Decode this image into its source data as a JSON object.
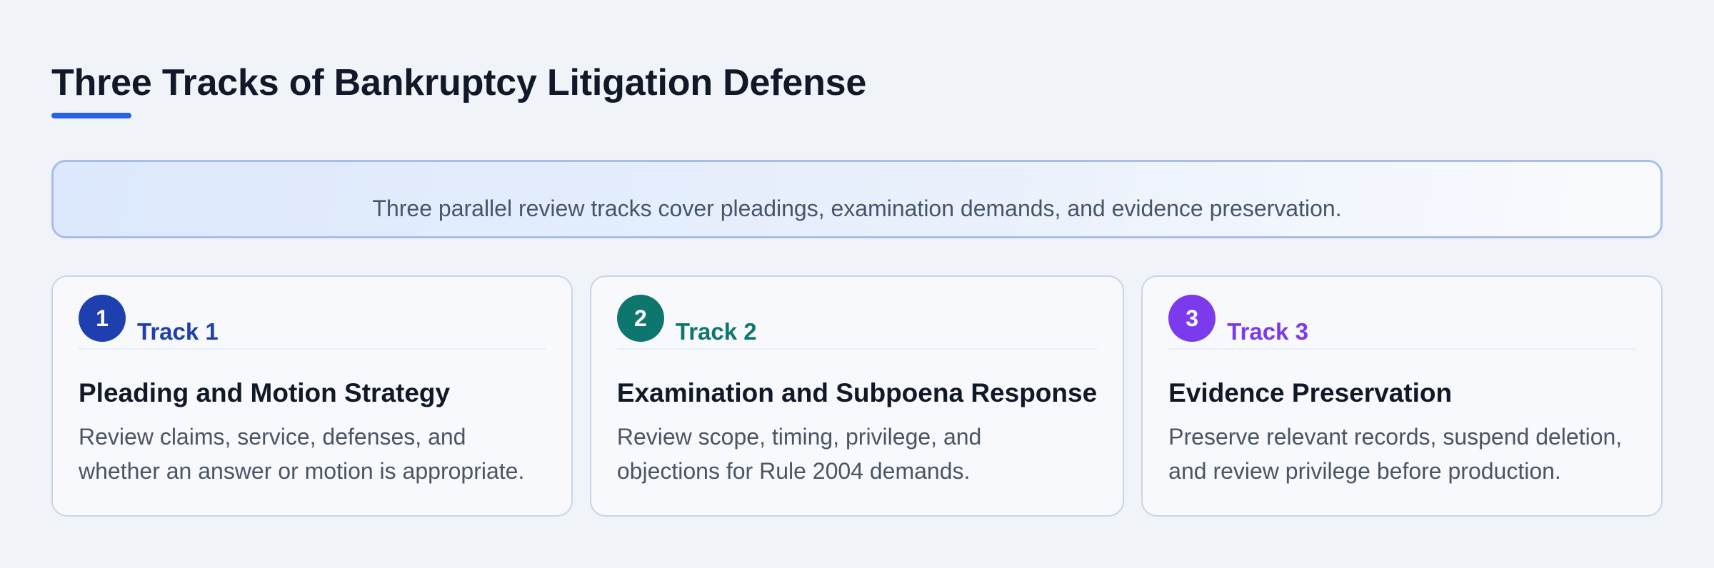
{
  "header": {
    "title": "Three Tracks of Bankruptcy Litigation Defense",
    "accent_color": "#2563eb"
  },
  "banner": {
    "text": "Three parallel review tracks cover pleadings, examination demands, and evidence preservation."
  },
  "tracks": [
    {
      "number": "1",
      "label": "Track 1",
      "color": "#1e40af",
      "title": "Pleading and Motion Strategy",
      "description": "Review claims, service, defenses, and whether an answer or motion is appropriate."
    },
    {
      "number": "2",
      "label": "Track 2",
      "color": "#0f766e",
      "title": "Examination and Subpoena Response",
      "description": "Review scope, timing, privilege, and objections for Rule 2004 demands."
    },
    {
      "number": "3",
      "label": "Track 3",
      "color": "#7c3aed",
      "title": "Evidence Preservation",
      "description": "Preserve relevant records, suspend deletion, and review privilege before production."
    }
  ]
}
